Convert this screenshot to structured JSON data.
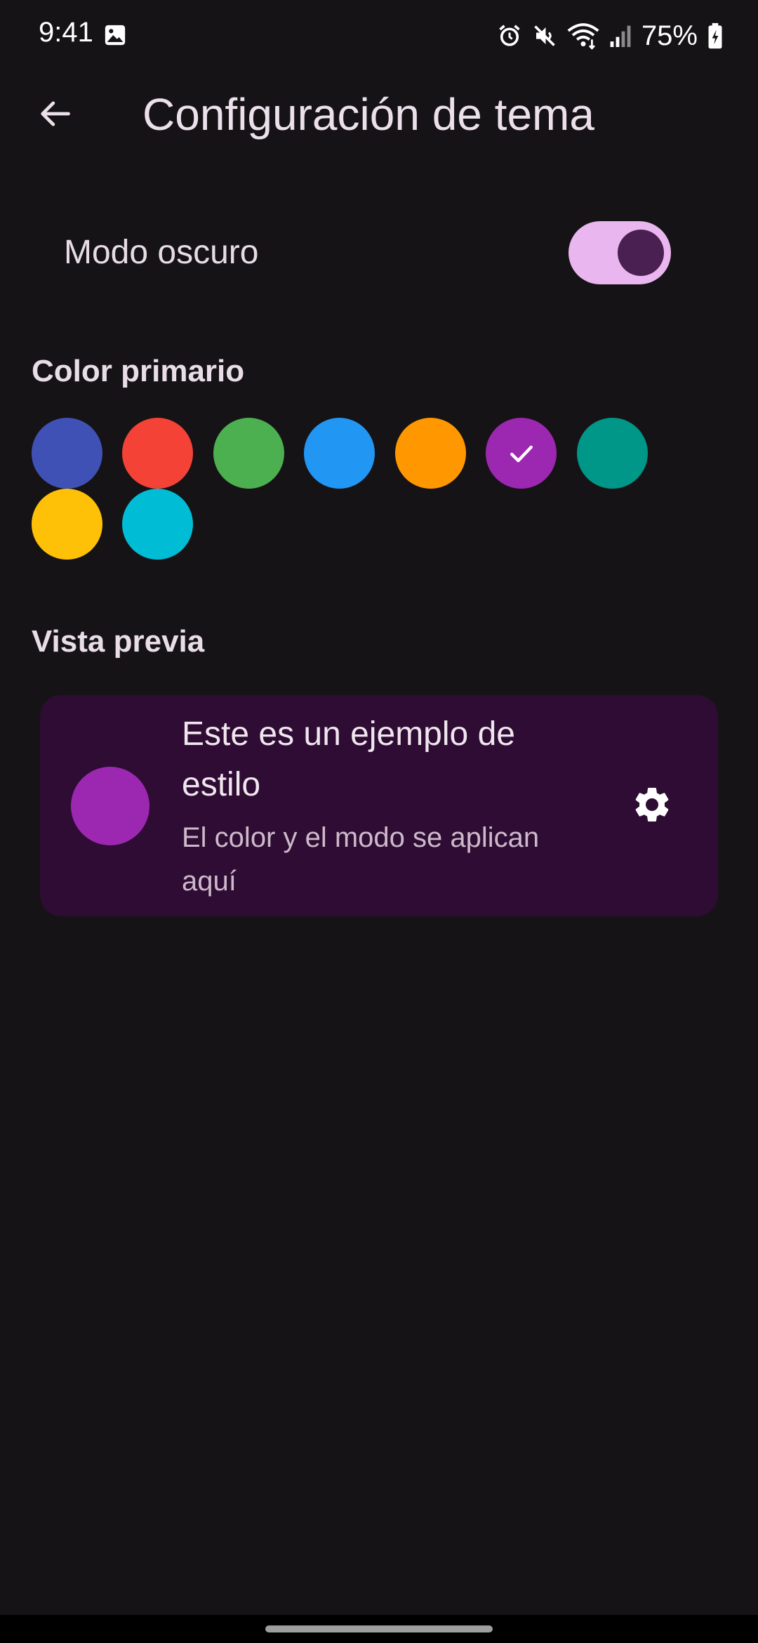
{
  "status_bar": {
    "time": "9:41",
    "battery": "75%",
    "icons": [
      "gallery-icon",
      "alarm-icon",
      "mute-icon",
      "wifi-icon",
      "signal-icon",
      "battery-charging-icon"
    ]
  },
  "app_bar": {
    "title": "Configuración de tema",
    "back_icon": "arrow-back-icon"
  },
  "dark_mode": {
    "label": "Modo oscuro",
    "enabled": true
  },
  "primary_color": {
    "title": "Color primario",
    "selected_index": 5,
    "options": [
      {
        "name": "indigo",
        "color": "#3F51B5"
      },
      {
        "name": "red",
        "color": "#F44336"
      },
      {
        "name": "green",
        "color": "#4CAF50"
      },
      {
        "name": "blue",
        "color": "#2196F3"
      },
      {
        "name": "orange",
        "color": "#FF9800"
      },
      {
        "name": "purple",
        "color": "#9C27B0"
      },
      {
        "name": "teal",
        "color": "#009688"
      },
      {
        "name": "amber",
        "color": "#FFC107"
      },
      {
        "name": "cyan",
        "color": "#00BCD4"
      }
    ]
  },
  "preview": {
    "title": "Vista previa",
    "card_title": "Este es un ejemplo de estilo",
    "card_subtitle": "El color y el modo se aplican aquí",
    "trailing_icon": "gear-icon",
    "accent_color": "#9C27B0"
  },
  "colors": {
    "background": "#161316",
    "card": "#2E0C33",
    "switch_track": "#EAB6EF",
    "switch_thumb": "#4A1F51"
  }
}
